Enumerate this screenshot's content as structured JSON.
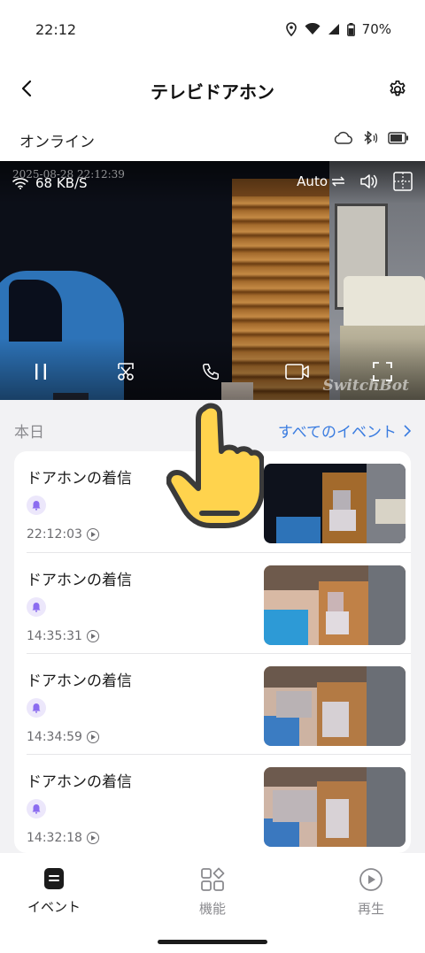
{
  "status_bar": {
    "time": "22:12",
    "battery": "70%"
  },
  "header": {
    "title": "テレビドアホン"
  },
  "device_status": {
    "label": "オンライン"
  },
  "video": {
    "timestamp": "2025-08-28 22:12:39",
    "speed": "68 KB/S",
    "mode": "Auto",
    "watermark": "SwitchBot"
  },
  "events_section": {
    "today_label": "本日",
    "all_events_link": "すべてのイベント"
  },
  "events": [
    {
      "title": "ドアホンの着信",
      "time": "22:12:03"
    },
    {
      "title": "ドアホンの着信",
      "time": "14:35:31"
    },
    {
      "title": "ドアホンの着信",
      "time": "14:34:59"
    },
    {
      "title": "ドアホンの着信",
      "time": "14:32:18"
    }
  ],
  "bottom_nav": [
    {
      "label": "イベント",
      "icon": "event-icon",
      "active": true
    },
    {
      "label": "機能",
      "icon": "features-icon",
      "active": false
    },
    {
      "label": "再生",
      "icon": "playback-icon",
      "active": false
    }
  ],
  "colors": {
    "accent": "#3a7ce0",
    "badge_bg": "#ece7fb",
    "badge_icon": "#8b6cf0",
    "active_nav": "#1b1b1b",
    "inactive_nav": "#8a8a8e"
  }
}
